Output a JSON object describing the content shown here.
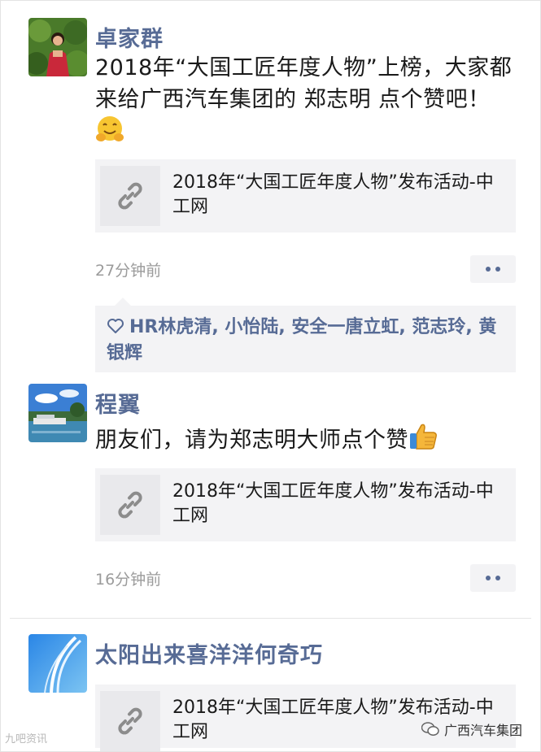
{
  "posts": [
    {
      "author": "卓家群",
      "text": "2018年“大国工匠年度人物”上榜，大家都来给广西汽车集团的 郑志明 点个赞吧！",
      "link_title": "2018年“大国工匠年度人物”发布活动-中工网",
      "time": "27分钟前",
      "emoji": "hug-emoji"
    },
    {
      "author": "程翼",
      "text": "朋友们，请为郑志明大师点个赞",
      "link_title": "2018年“大国工匠年度人物”发布活动-中工网",
      "time": "16分钟前",
      "emoji": "thumbs-up-emoji"
    },
    {
      "author": "太阳出来喜洋洋何奇巧",
      "link_title": "2018年“大国工匠年度人物”发布活动-中工网"
    }
  ],
  "likes": {
    "names": "HR林虎清, 小怡陆, 安全一唐立虹, 范志玲, 黄银辉"
  },
  "watermarks": {
    "left": "九吧资讯",
    "right": "广西汽车集团"
  },
  "icons": [
    "link-icon",
    "heart-icon",
    "more-dots-icon",
    "wechat-icon"
  ],
  "colors": {
    "name_blue": "#576b95",
    "card_bg": "#f3f3f5",
    "time_gray": "#9b9b9b"
  }
}
